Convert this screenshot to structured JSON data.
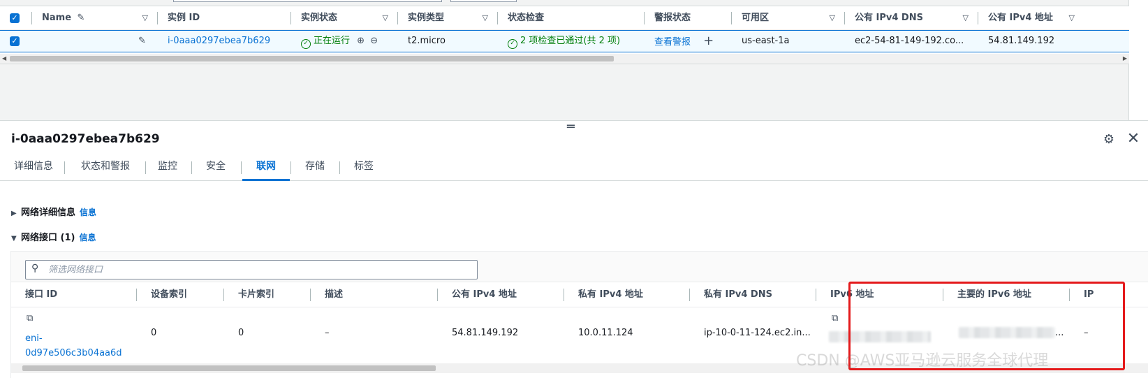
{
  "instances_table": {
    "columns": [
      {
        "label": "Name"
      },
      {
        "label": "实例 ID"
      },
      {
        "label": "实例状态"
      },
      {
        "label": "实例类型"
      },
      {
        "label": "状态检查"
      },
      {
        "label": "警报状态"
      },
      {
        "label": "可用区"
      },
      {
        "label": "公有 IPv4 DNS"
      },
      {
        "label": "公有 IPv4 地址"
      }
    ],
    "row": {
      "selected": true,
      "name": "",
      "instance_id": "i-0aaa0297ebea7b629",
      "instance_state": "正在运行",
      "instance_type": "t2.micro",
      "status_check": "2 项检查已通过(共 2 项)",
      "alarm_status": "查看警报",
      "availability_zone": "us-east-1a",
      "public_ipv4_dns": "ec2-54-81-149-192.co...",
      "public_ipv4_address": "54.81.149.192"
    }
  },
  "detail_panel": {
    "title": "i-0aaa0297ebea7b629",
    "tabs": [
      "详细信息",
      "状态和警报",
      "监控",
      "安全",
      "联网",
      "存储",
      "标签"
    ],
    "active_tab": "联网",
    "sections": {
      "network_details": {
        "label": "网络详细信息",
        "info": "信息",
        "expanded": false
      },
      "network_interfaces": {
        "label": "网络接口 (1)",
        "info": "信息",
        "expanded": true
      }
    },
    "filter": {
      "placeholder": "筛选网络接口",
      "value": ""
    },
    "interface_columns": [
      "接口 ID",
      "设备索引",
      "卡片索引",
      "描述",
      "公有 IPv4 地址",
      "私有 IPv4 地址",
      "私有 IPv4 DNS",
      "IPv6 地址",
      "主要的 IPv6 地址",
      "IP"
    ],
    "interface_row": {
      "interface_id_line1": "eni-",
      "interface_id_line2": "0d97e506c3b04aa6d",
      "device_index": "0",
      "card_index": "0",
      "description": "–",
      "public_ipv4": "54.81.149.192",
      "private_ipv4": "10.0.11.124",
      "private_ipv4_dns": "ip-10-0-11-124.ec2.in...",
      "primary_ipv6_suffix": "...",
      "last_cell": "–"
    }
  },
  "watermark": "CSDN @AWS亚马逊云服务全球代理",
  "colors": {
    "accent": "#0972d3",
    "success": "#037f0c",
    "highlight": "#e4191b"
  },
  "icons": [
    "sort-triangle-icon",
    "edit-pencil-icon",
    "zoom-in-icon",
    "zoom-out-icon",
    "plus-icon",
    "gear-icon",
    "close-icon",
    "copy-icon",
    "search-icon",
    "check-circle-icon"
  ]
}
